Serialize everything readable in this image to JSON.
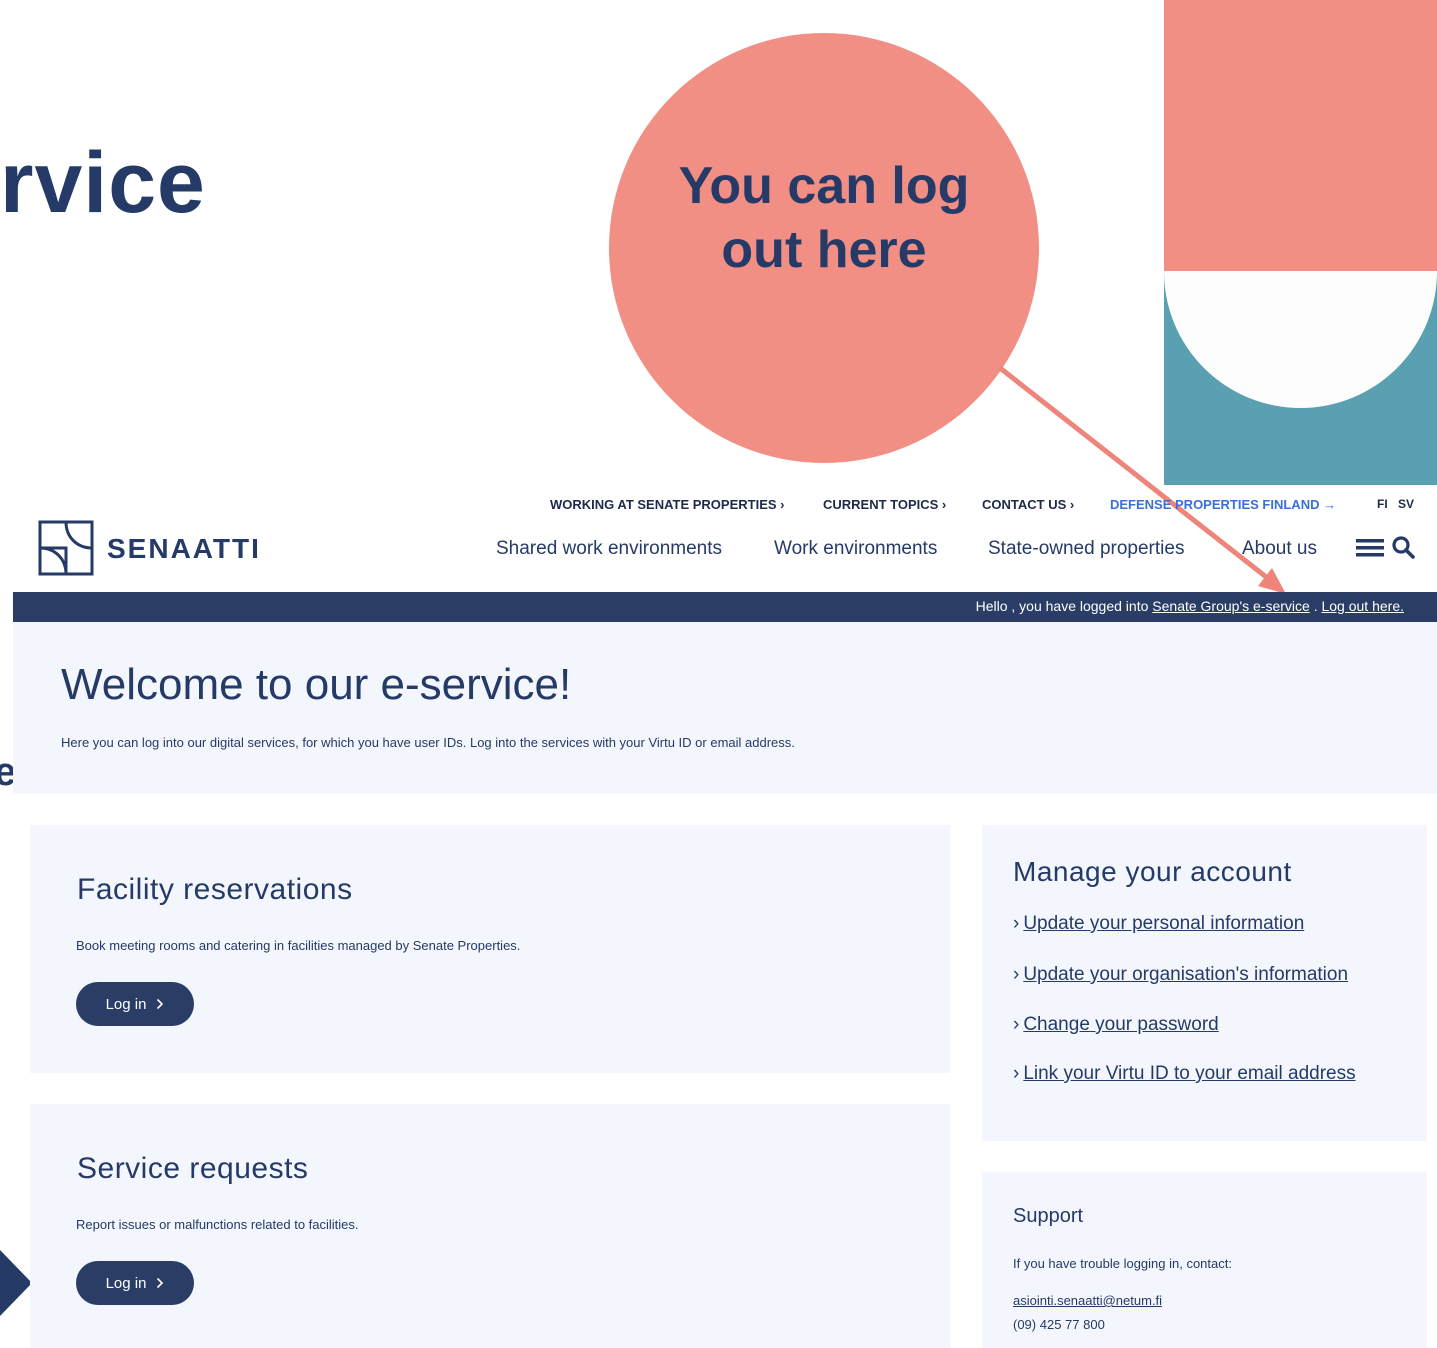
{
  "slide": {
    "title_fragment": "rvice",
    "callout_text": "You can log out here",
    "left_edge_fragment": "e"
  },
  "colors": {
    "navy": "#253a66",
    "coral": "#f18f84",
    "teal": "#5aa0b0",
    "panel": "#f3f6fc",
    "link_blue": "#3a6fd8"
  },
  "top_nav": {
    "working": "WORKING AT SENATE PROPERTIES ›",
    "topics": "CURRENT TOPICS ›",
    "contact": "CONTACT US ›",
    "defense": "DEFENSE PROPERTIES FINLAND →",
    "lang_fi": "FI",
    "lang_sv": "SV"
  },
  "logo": {
    "text": "SENAATTI",
    "icon": "senaatti-logo-icon"
  },
  "main_nav": {
    "shared": "Shared work environments",
    "work": "Work environments",
    "state": "State-owned properties",
    "about": "About us",
    "menu_icon": "hamburger-menu-icon",
    "search_icon": "search-icon"
  },
  "hello_bar": {
    "prefix": "Hello , you have logged into ",
    "eservice_link": "Senate Group's e-service",
    "middle": " . ",
    "logout_link": "Log out here."
  },
  "welcome": {
    "title": "Welcome to our e-service!",
    "description": "Here you can log into our digital services, for which you have user IDs. Log into the services with your Virtu ID or email address."
  },
  "facility": {
    "title": "Facility reservations",
    "description": "Book meeting rooms and catering in facilities managed by Senate Properties.",
    "button": "Log in",
    "button_icon": "chevron-right-icon"
  },
  "service": {
    "title": "Service requests",
    "description": "Report issues or malfunctions related to facilities.",
    "button": "Log in",
    "button_icon": "chevron-right-icon"
  },
  "account": {
    "title": "Manage your account",
    "links": [
      "Update your personal information",
      "Update your organisation's information",
      "Change your password",
      "Link your Virtu ID to your email address"
    ],
    "chevron": "›"
  },
  "support": {
    "title": "Support",
    "description": "If you have trouble logging in, contact:",
    "email": "asiointi.senaatti@netum.fi",
    "phone": "(09) 425 77 800"
  }
}
